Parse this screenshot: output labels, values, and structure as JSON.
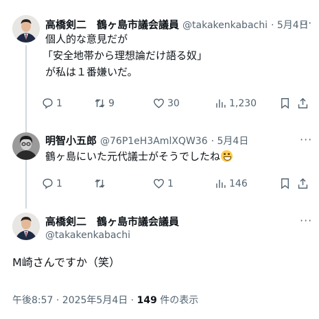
{
  "post1": {
    "display_name": "高橋剣二　鶴ヶ島市議会議員",
    "handle": "@takakenkabachi",
    "date": "· 5月4日",
    "lines": [
      "個人的な意見だが",
      "「安全地帯から理想論だけ語る奴」",
      "が私は１番嫌いだ。"
    ],
    "replies": "1",
    "reposts": "9",
    "likes": "30",
    "views": "1,230"
  },
  "post2": {
    "display_name": "明智小五郎",
    "handle": "@76P1eH3AmlXQW36",
    "date": "· 5月4日",
    "text": "鶴ヶ島にいた元代議士がそうでしたね",
    "replies": "1",
    "reposts": "",
    "likes": "1",
    "views": "146"
  },
  "post3": {
    "display_name": "高橋剣二　鶴ヶ島市議会議員",
    "handle": "@takakenkabachi",
    "text": "M崎さんですか（笑）",
    "timestamp": "午後8:57 · 2025年5月4日 · ",
    "view_count": "149",
    "view_label": " 件の表示"
  },
  "more_label": "···",
  "icons": [
    "reply-icon",
    "repost-icon",
    "like-icon",
    "views-icon",
    "bookmark-icon",
    "share-icon",
    "emoji-grin-icon"
  ],
  "colors": {
    "text": "#0f1419",
    "secondary": "#536471",
    "thread_line": "#cfd9de"
  }
}
